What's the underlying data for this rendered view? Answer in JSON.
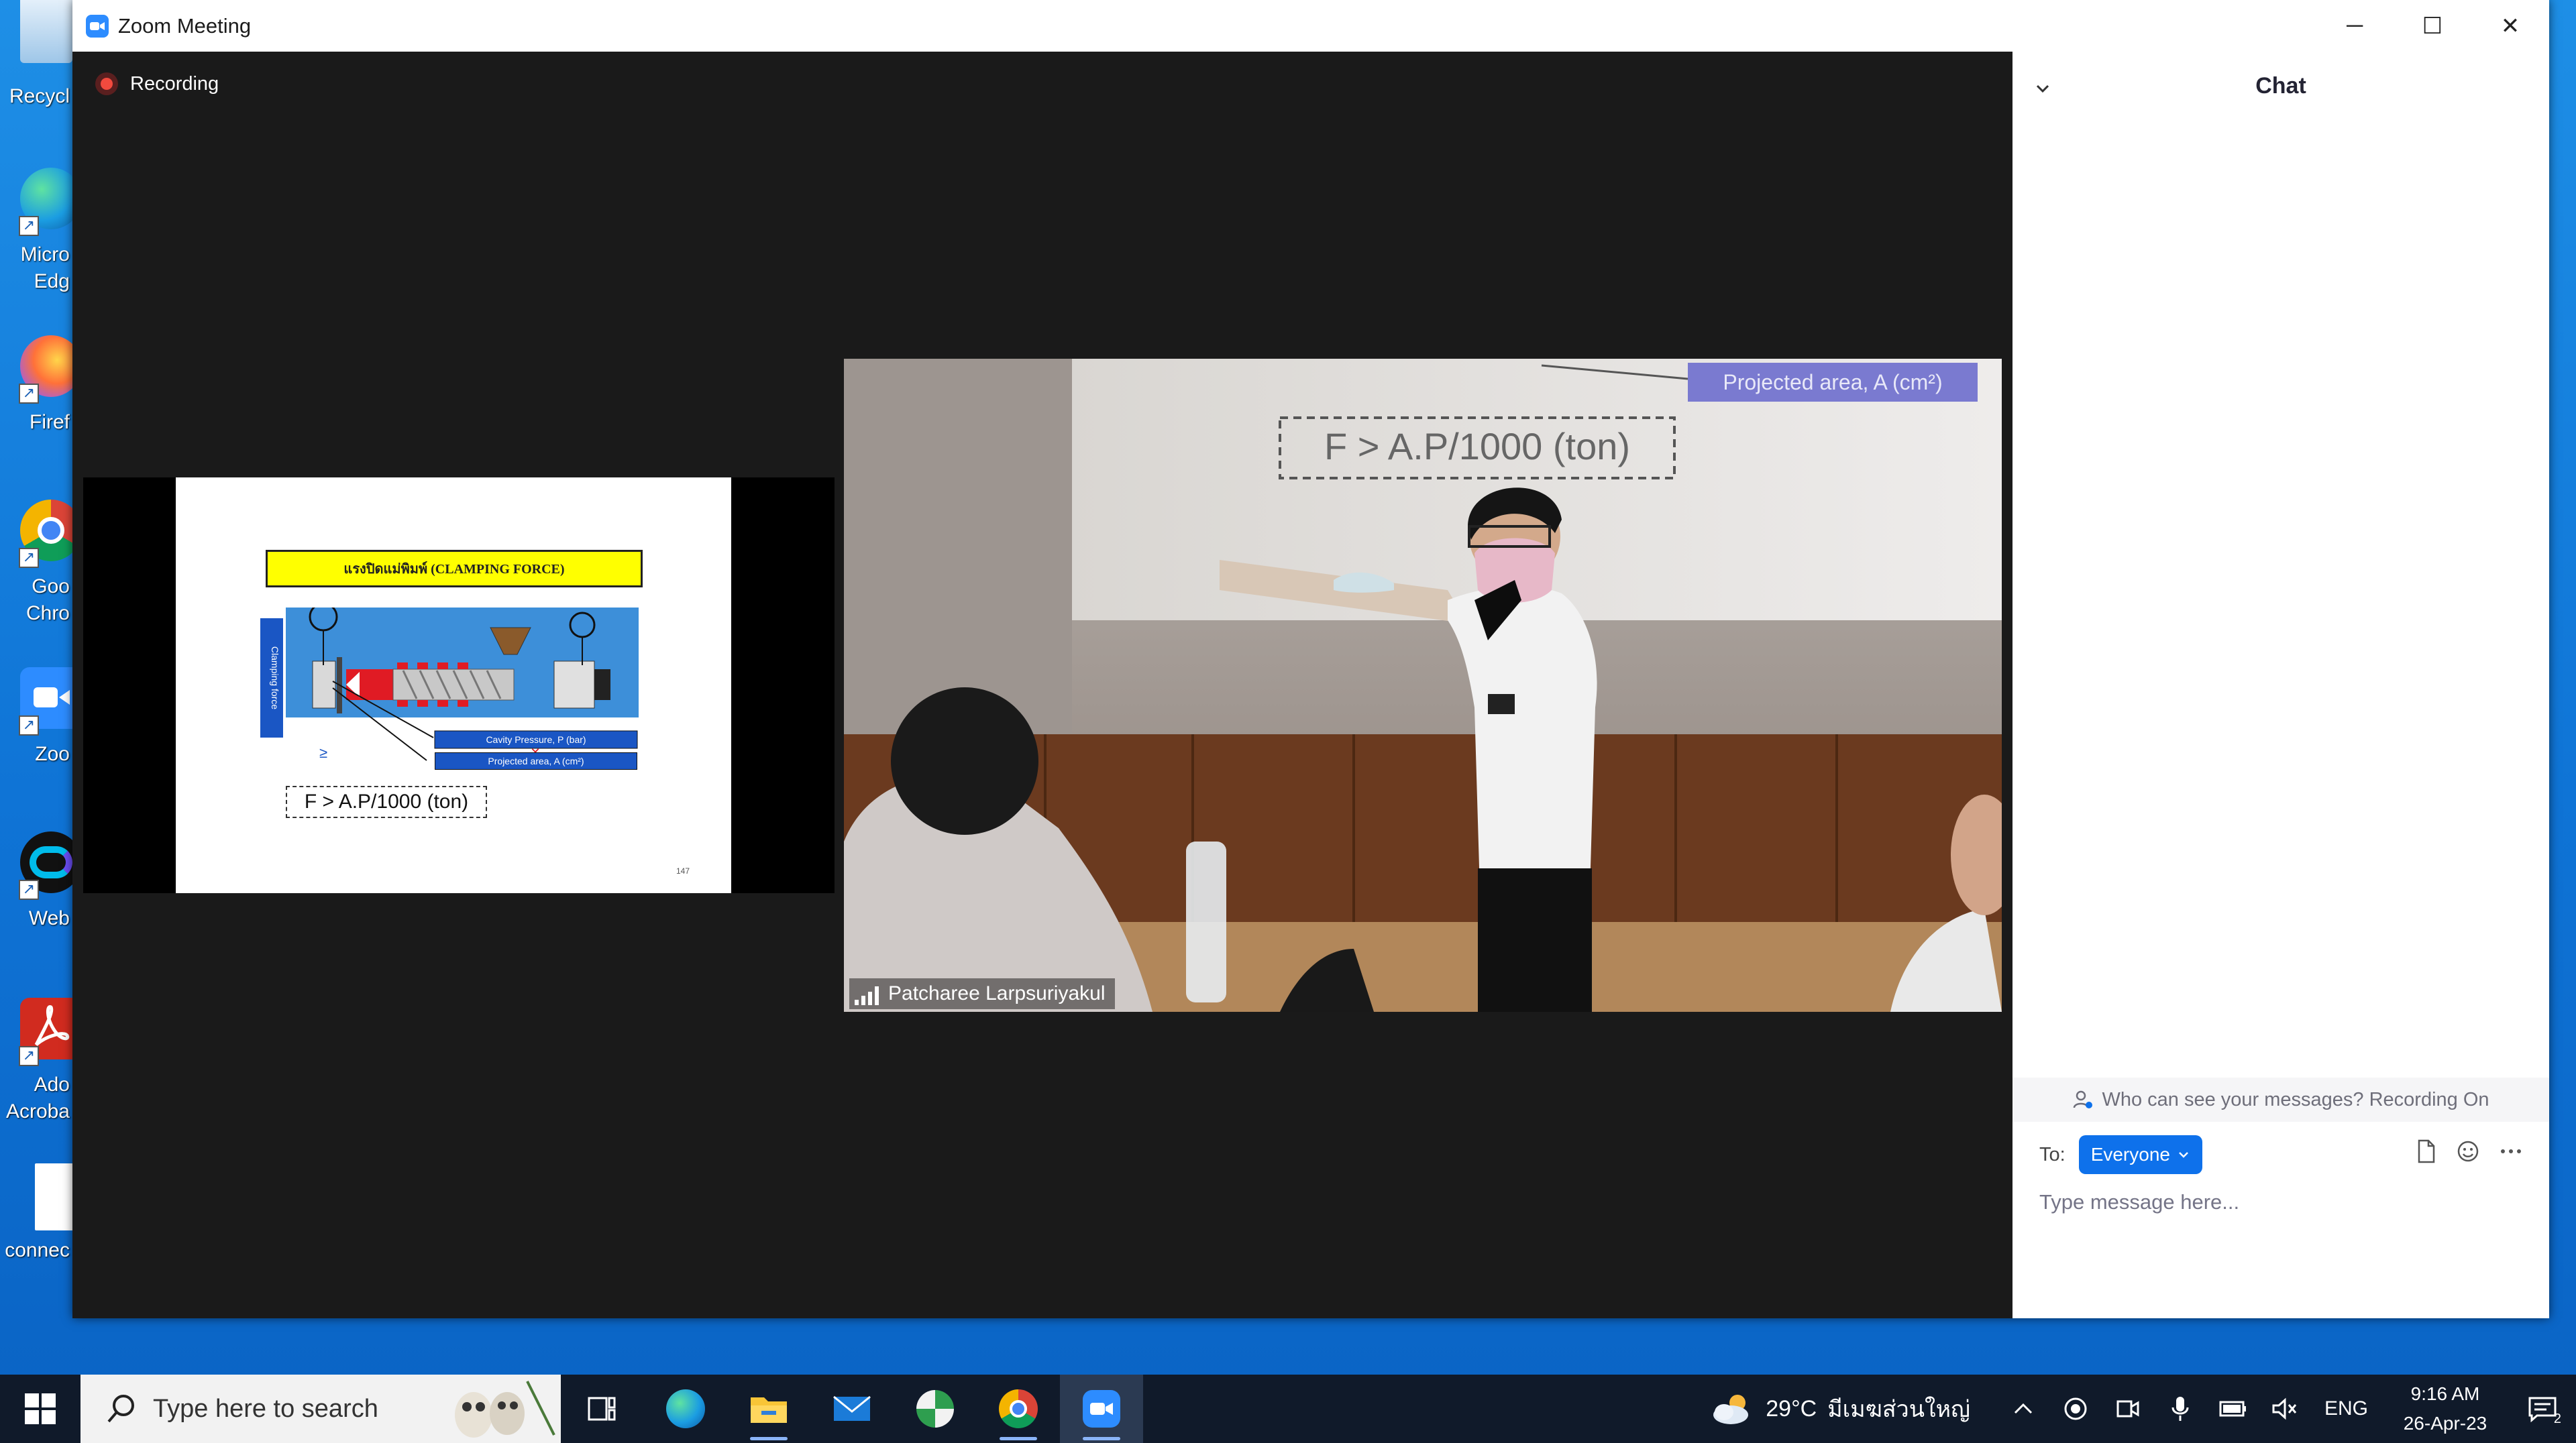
{
  "desktop": {
    "icons": [
      {
        "label": "Recycl",
        "icon": "recycle-bin-icon"
      },
      {
        "label": "Micro\nEdg",
        "icon": "edge-icon"
      },
      {
        "label": "Firef",
        "icon": "firefox-icon"
      },
      {
        "label": "Goo\nChro",
        "icon": "chrome-icon"
      },
      {
        "label": "Zoo",
        "icon": "zoom-icon"
      },
      {
        "label": "Web",
        "icon": "webex-icon"
      },
      {
        "label": "Ado\nAcroba",
        "icon": "acrobat-icon"
      },
      {
        "label": "connec",
        "icon": "file-icon"
      }
    ]
  },
  "window": {
    "title": "Zoom Meeting",
    "controls": {
      "minimize": "─",
      "maximize": "☐",
      "close": "✕"
    }
  },
  "meeting": {
    "recording_label": "Recording",
    "participant_name": "Patcharee Larpsuriyakul"
  },
  "slide": {
    "title": "แรงปิดแม่พิมพ์ (CLAMPING FORCE)",
    "clamping_label": "Clamping force",
    "cavity_label": "Cavity Pressure, P (bar)",
    "area_label": "Projected area, A  (cm²)",
    "ge_symbol": "≥",
    "formula": "F > A.P/1000 (ton)",
    "page_number": "147"
  },
  "camera_scene": {
    "projected_label": "Projected area, A  (cm²)",
    "formula": "F > A.P/1000 (ton)"
  },
  "chat": {
    "title": "Chat",
    "notice": "Who can see your messages? Recording On",
    "to_label": "To:",
    "recipient": "Everyone",
    "input_placeholder": "Type message here..."
  },
  "taskbar": {
    "search_placeholder": "Type here to search",
    "apps": [
      "task-view-icon",
      "edge-icon",
      "file-explorer-icon",
      "mail-icon",
      "maps-icon",
      "chrome-icon",
      "zoom-icon"
    ],
    "weather_temp": "29°C",
    "weather_location": "มีเมฆส่วนใหญ่",
    "language": "ENG",
    "time": "9:16 AM",
    "date": "26-Apr-23",
    "notification_count": "2"
  }
}
